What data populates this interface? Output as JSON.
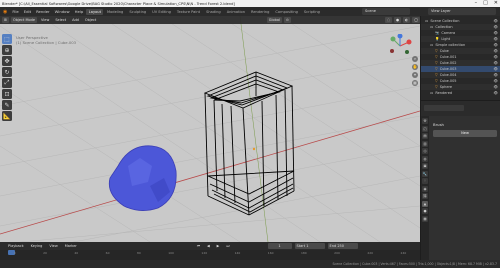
{
  "window": {
    "title": "Blender* [C:\\All_Essential Softwares\\Google Drive\\BAG Studio 2020\\Character Place & Simulation_CPS\\N\\N - Trend Forest 2.blend]",
    "controls": [
      "–",
      "□",
      "✕"
    ]
  },
  "menu": [
    "File",
    "Edit",
    "Render",
    "Window",
    "Help"
  ],
  "workspaces": [
    "Layout",
    "Modeling",
    "Sculpting",
    "UV Editing",
    "Texture Paint",
    "Shading",
    "Animation",
    "Rendering",
    "Compositing",
    "Scripting"
  ],
  "active_workspace": "Layout",
  "scene": {
    "label": "Scene",
    "view_layer": "View Layer"
  },
  "viewport": {
    "mode": "Object Mode",
    "menus": [
      "View",
      "Select",
      "Add",
      "Object"
    ],
    "orientation": "Global",
    "view_label": "User Perspective",
    "collection_label": "(1) Scene Collection | Cube.003",
    "options_label": "Options",
    "tools": [
      "cursor",
      "move",
      "rotate",
      "scale",
      "transform",
      "annotate",
      "measure"
    ]
  },
  "gizmo": {
    "x": "X",
    "y": "Y",
    "z": "Z"
  },
  "timeline": {
    "menus": [
      "Playback",
      "Keying",
      "View",
      "Marker"
    ],
    "current_frame": "1",
    "start_label": "Start",
    "start": "1",
    "end_label": "End",
    "end": "250",
    "ruler": [
      "0",
      "20",
      "40",
      "60",
      "80",
      "100",
      "120",
      "140",
      "160",
      "180",
      "200",
      "220",
      "240"
    ]
  },
  "outliner": {
    "rows": [
      {
        "label": "Scene Collection",
        "indent": 0,
        "icon": "collection"
      },
      {
        "label": "Collection",
        "indent": 1,
        "icon": "collection"
      },
      {
        "label": "Camera",
        "indent": 2,
        "icon": "camera"
      },
      {
        "label": "Light",
        "indent": 2,
        "icon": "light"
      },
      {
        "label": "Simple collection",
        "indent": 1,
        "icon": "collection"
      },
      {
        "label": "Cube",
        "indent": 2,
        "icon": "mesh"
      },
      {
        "label": "Cube.001",
        "indent": 2,
        "icon": "mesh"
      },
      {
        "label": "Cube.002",
        "indent": 2,
        "icon": "mesh"
      },
      {
        "label": "Cube.003",
        "indent": 2,
        "icon": "mesh"
      },
      {
        "label": "Cube.004",
        "indent": 2,
        "icon": "mesh"
      },
      {
        "label": "Cube.005",
        "indent": 2,
        "icon": "mesh"
      },
      {
        "label": "Sphere",
        "indent": 2,
        "icon": "mesh"
      },
      {
        "label": "Rendered",
        "indent": 1,
        "icon": "collection"
      }
    ]
  },
  "properties": {
    "title": "Brush",
    "add_label": "New"
  },
  "statusbar": {
    "left": "",
    "stats": "Scene Collection | Cube.003 | Verts:467 | Faces:500 | Tris:1,000 | Objects:1/8 | Mem: 68.7 MiB | v2.83.7"
  }
}
